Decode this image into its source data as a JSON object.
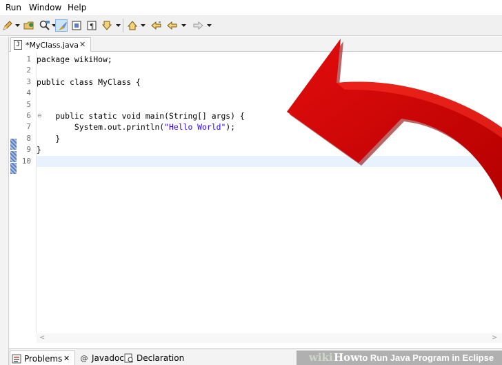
{
  "menubar": {
    "items": [
      "Run",
      "Window",
      "Help"
    ]
  },
  "toolbar": {
    "icons": [
      "pencil-icon",
      "open-folder-icon",
      "search-flashlight-icon",
      "brush-icon",
      "toggle-block-icon",
      "pilcrow-icon",
      "next-annotation-icon",
      "last-edit-location-icon",
      "back-icon",
      "forward-icon"
    ]
  },
  "editor": {
    "tab_label": "*MyClass.java",
    "tab_close": "✕",
    "tab_icon_glyph": "J",
    "line_numbers": [
      "1",
      "2",
      "3",
      "4",
      "5",
      "6",
      "7",
      "8",
      "9",
      "10"
    ],
    "lines": [
      "package wikiHow;",
      "",
      "public class MyClass {",
      "",
      "",
      "    public static void main(String[] args) {",
      "        System.out.println(\"Hello World\");",
      "    }",
      "}",
      ""
    ],
    "line7_prefix": "        System.out.println(",
    "line7_string": "\"Hello World\"",
    "line7_suffix": ");",
    "fold_marker": "⊖",
    "scroll_left": "<",
    "scroll_right": ">"
  },
  "bottom_tabs": {
    "problems_label": "Problems",
    "problems_close": "✕",
    "javadoc_label": "Javadoc",
    "declaration_label": "Declaration"
  },
  "watermark": {
    "wiki": "wiki",
    "how": "How",
    "title": "to Run Java Program in Eclipse"
  },
  "colors": {
    "arrow_red": "#e30d0d",
    "arrow_dark": "#8e0000",
    "string_blue": "#2a00ff",
    "current_line": "#e8f2fe",
    "change_marker": "#5a7fbf"
  }
}
